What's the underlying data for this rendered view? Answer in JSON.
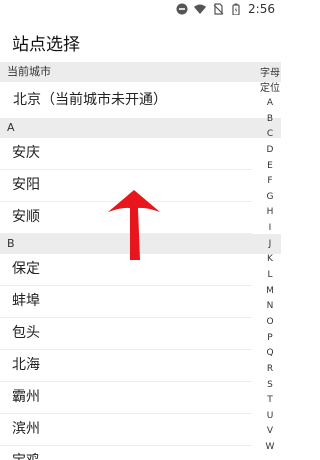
{
  "status_bar": {
    "time": "2:56",
    "icons": [
      "do-not-disturb-icon",
      "wifi-icon",
      "no-sim-icon",
      "battery-icon"
    ]
  },
  "header": {
    "title": "站点选择"
  },
  "current_city": {
    "label": "当前城市",
    "value": "北京（当前城市未开通）"
  },
  "sections": [
    {
      "letter": "A",
      "cities": [
        "安庆",
        "安阳",
        "安顺"
      ]
    },
    {
      "letter": "B",
      "cities": [
        "保定",
        "蚌埠",
        "包头",
        "北海",
        "霸州",
        "滨州",
        "宝鸡"
      ]
    }
  ],
  "index_bar": {
    "title": "字母",
    "locate": "定位",
    "letters": [
      "A",
      "B",
      "C",
      "D",
      "E",
      "F",
      "G",
      "H",
      "I",
      "J",
      "K",
      "L",
      "M",
      "N",
      "O",
      "P",
      "Q",
      "R",
      "S",
      "T",
      "U",
      "V",
      "W"
    ]
  },
  "colors": {
    "arrow": "#e8161c",
    "section_bg": "#ececec"
  }
}
